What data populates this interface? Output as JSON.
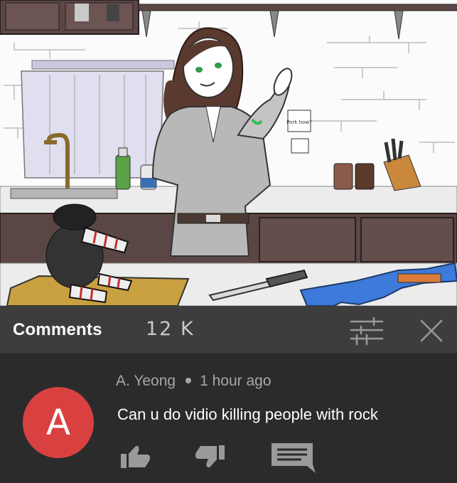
{
  "header": {
    "title": "Comments",
    "count": "12 K"
  },
  "comment": {
    "avatar_letter": "A",
    "author": "A. Yeong",
    "time": "1 hour ago",
    "text": "Can u do vidio killing people with rock"
  },
  "scene_note_text": "Pork how?",
  "icons": {
    "filter": "filter-sliders-icon",
    "close": "close-icon",
    "like": "thumbs-up-icon",
    "dislike": "thumbs-down-icon",
    "reply": "reply-comment-icon"
  },
  "colors": {
    "header_bg": "#3d3d3d",
    "comment_bg": "#2b2b2b",
    "avatar": "#d94141",
    "text_primary": "#ffffff",
    "text_secondary": "#a6a6a6"
  }
}
